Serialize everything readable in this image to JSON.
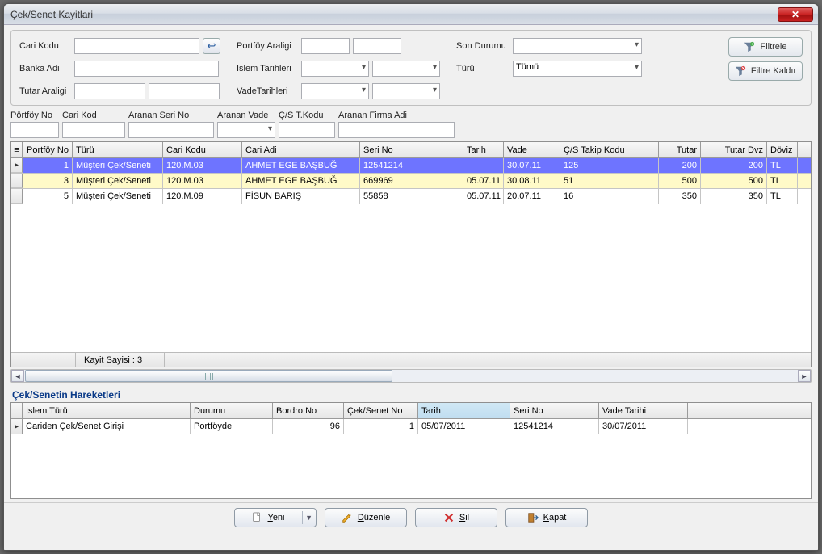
{
  "window": {
    "title": "Çek/Senet Kayitlari"
  },
  "filters": {
    "cari_kodu_lbl": "Cari Kodu",
    "banka_adi_lbl": "Banka Adi",
    "tutar_araligi_lbl": "Tutar Araligi",
    "portfoy_araligi_lbl": "Portföy Araligi",
    "islem_tarihleri_lbl": "Islem Tarihleri",
    "vade_tarihleri_lbl": "VadeTarihleri",
    "son_durumu_lbl": "Son Durumu",
    "turu_lbl": "Türü",
    "turu_value": "Tümü",
    "filtrele_btn": "Filtrele",
    "filtre_kaldir_btn": "Filtre Kaldır"
  },
  "quick": {
    "portfoy_no": "Pörtföy No",
    "cari_kod": "Cari Kod",
    "aranan_seri": "Aranan Seri No",
    "aranan_vade": "Aranan Vade",
    "cs_tkodu": "Ç/S T.Kodu",
    "aranan_firma": "Aranan Firma Adi"
  },
  "grid": {
    "headers": {
      "portfoy_no": "Portföy No",
      "turu": "Türü",
      "cari_kodu": "Cari Kodu",
      "cari_adi": "Cari Adi",
      "seri_no": "Seri No",
      "tarih": "Tarih",
      "vade": "Vade",
      "takip": "Ç/S Takip Kodu",
      "tutar": "Tutar",
      "tutar_dvz": "Tutar Dvz",
      "doviz": "Döviz"
    },
    "rows": [
      {
        "portfoy": "1",
        "turu": "Müşteri Çek/Seneti",
        "cari_kodu": "120.M.03",
        "cari_adi": "AHMET EGE BAŞBUĞ",
        "seri": "12541214",
        "tarih": "",
        "vade": "30.07.11",
        "takip": "125",
        "tutar": "200",
        "tutardvz": "200",
        "doviz": "TL"
      },
      {
        "portfoy": "3",
        "turu": "Müşteri Çek/Seneti",
        "cari_kodu": "120.M.03",
        "cari_adi": "AHMET EGE BAŞBUĞ",
        "seri": "669969",
        "tarih": "05.07.11",
        "vade": "30.08.11",
        "takip": "51",
        "tutar": "500",
        "tutardvz": "500",
        "doviz": "TL"
      },
      {
        "portfoy": "5",
        "turu": "Müşteri Çek/Seneti",
        "cari_kodu": "120.M.09",
        "cari_adi": "FİSUN BARIŞ",
        "seri": "55858",
        "tarih": "05.07.11",
        "vade": "20.07.11",
        "takip": "16",
        "tutar": "350",
        "tutardvz": "350",
        "doviz": "TL"
      }
    ],
    "status": "Kayit Sayisi : 3"
  },
  "section2_title": "Çek/Senetin Hareketleri",
  "grid2": {
    "headers": {
      "islem": "Islem Türü",
      "durumu": "Durumu",
      "bordro": "Bordro No",
      "ceksenet": "Çek/Senet No",
      "tarih": "Tarih",
      "seri": "Seri No",
      "vade": "Vade Tarihi"
    },
    "row": {
      "islem": "Cariden Çek/Senet Girişi",
      "durumu": "Portföyde",
      "bordro": "96",
      "ceksenet": "1",
      "tarih": "05/07/2011",
      "seri": "12541214",
      "vade": "30/07/2011"
    }
  },
  "footer": {
    "yeni": "Yeni",
    "duzenle": "Düzenle",
    "sil": "Sil",
    "kapat": "Kapat"
  }
}
